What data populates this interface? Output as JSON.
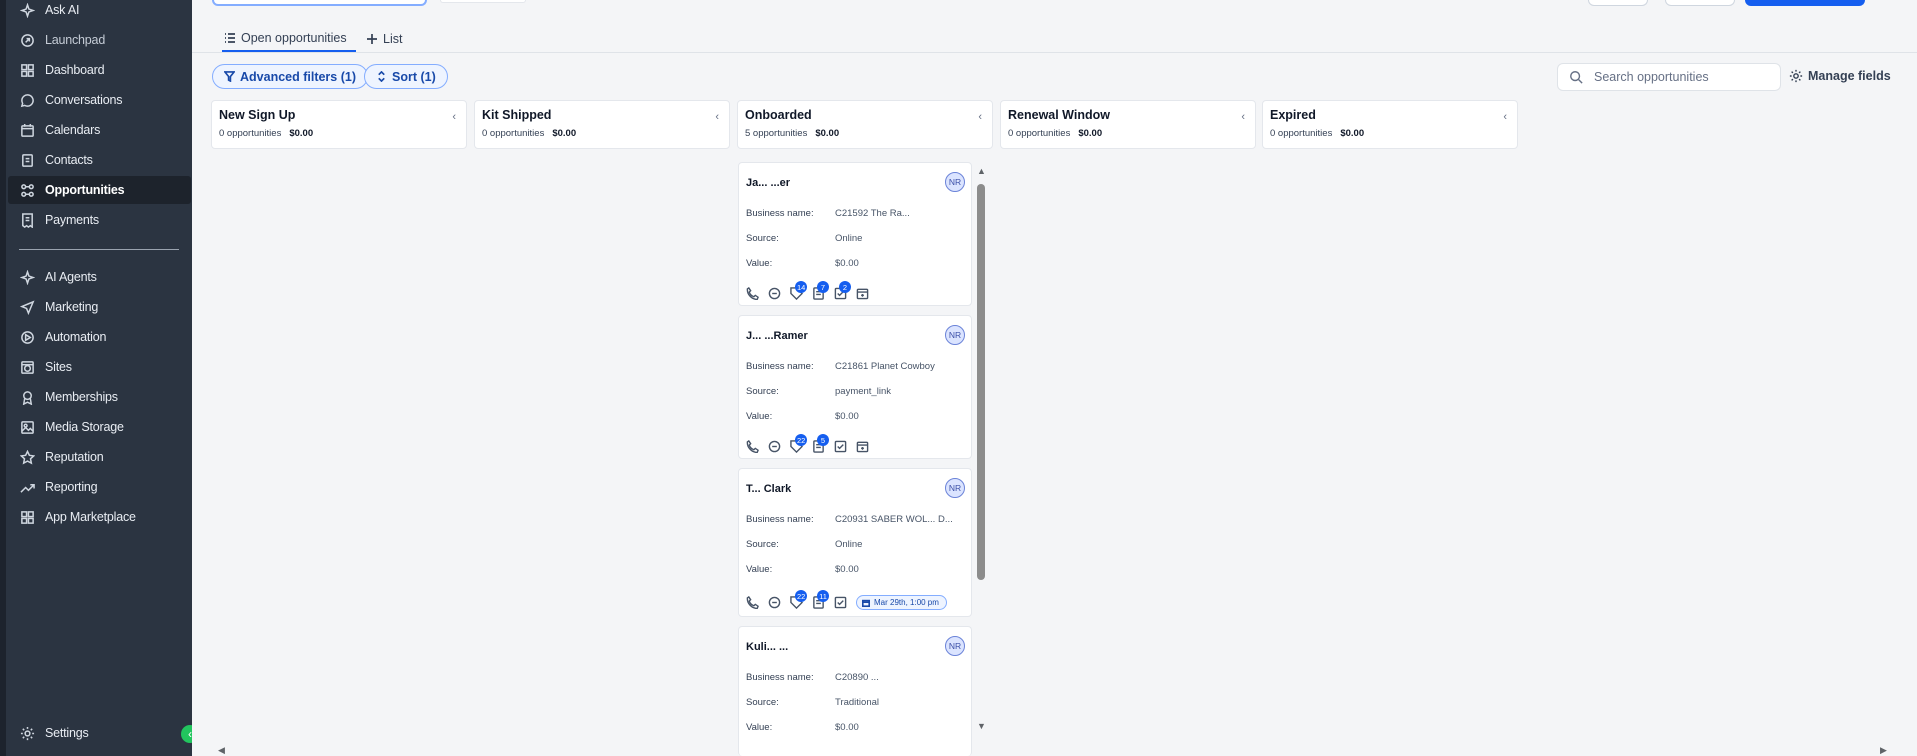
{
  "sidebar": {
    "items": [
      {
        "label": "Ask AI",
        "icon": "sparkle-icon"
      },
      {
        "label": "Launchpad",
        "icon": "rocket-icon"
      },
      {
        "label": "Dashboard",
        "icon": "grid-icon"
      },
      {
        "label": "Conversations",
        "icon": "chat-bubble-icon"
      },
      {
        "label": "Calendars",
        "icon": "calendar-icon"
      },
      {
        "label": "Contacts",
        "icon": "contacts-icon"
      },
      {
        "label": "Opportunities",
        "icon": "pipeline-icon"
      },
      {
        "label": "Payments",
        "icon": "receipt-icon"
      },
      {
        "label": "AI Agents",
        "icon": "sparkle-icon"
      },
      {
        "label": "Marketing",
        "icon": "send-icon"
      },
      {
        "label": "Automation",
        "icon": "automation-icon"
      },
      {
        "label": "Sites",
        "icon": "globe-icon"
      },
      {
        "label": "Memberships",
        "icon": "award-icon"
      },
      {
        "label": "Media Storage",
        "icon": "image-icon"
      },
      {
        "label": "Reputation",
        "icon": "star-icon"
      },
      {
        "label": "Reporting",
        "icon": "trend-icon"
      },
      {
        "label": "App Marketplace",
        "icon": "apps-icon"
      }
    ],
    "settings_label": "Settings",
    "active": "Opportunities"
  },
  "tabs": [
    {
      "label": "Open opportunities",
      "active": true
    },
    {
      "label": "List",
      "active": false
    }
  ],
  "filters": {
    "advanced_label": "Advanced filters (1)",
    "sort_label": "Sort (1)"
  },
  "search": {
    "placeholder": "Search opportunities"
  },
  "manage_fields_label": "Manage fields",
  "columns": [
    {
      "name": "New Sign Up",
      "count": "0 opportunities",
      "value": "$0.00"
    },
    {
      "name": "Kit Shipped",
      "count": "0 opportunities",
      "value": "$0.00"
    },
    {
      "name": "Onboarded",
      "count": "5 opportunities",
      "value": "$0.00"
    },
    {
      "name": "Renewal Window",
      "count": "0 opportunities",
      "value": "$0.00"
    },
    {
      "name": "Expired",
      "count": "0 opportunities",
      "value": "$0.00"
    }
  ],
  "field_labels": {
    "business": "Business name:",
    "source": "Source:",
    "value": "Value:"
  },
  "cards": [
    {
      "title": "Ja... ...er",
      "avatar": "NR",
      "business": "C21592 The Ra...",
      "source": "Online",
      "value": "$0.00",
      "badges": {
        "tag": "14",
        "note": "7",
        "task": "2"
      },
      "appointment": ""
    },
    {
      "title": "J... ...Ramer",
      "avatar": "NR",
      "business": "C21861 Planet Cowboy",
      "source": "payment_link",
      "value": "$0.00",
      "badges": {
        "tag": "22",
        "note": "5",
        "task": ""
      },
      "appointment": ""
    },
    {
      "title": "T... Clark",
      "avatar": "NR",
      "business": "C20931 SABER WOL... D...",
      "source": "Online",
      "value": "$0.00",
      "badges": {
        "tag": "22",
        "note": "11",
        "task": ""
      },
      "appointment": "Mar 29th, 1:00 pm"
    },
    {
      "title": "Kuli... ...",
      "avatar": "NR",
      "business": "C20890 ...",
      "source": "Traditional",
      "value": "$0.00",
      "badges": {
        "tag": "",
        "note": "",
        "task": ""
      },
      "appointment": ""
    }
  ]
}
